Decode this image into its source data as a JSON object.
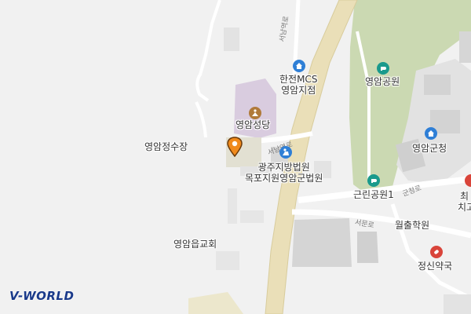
{
  "map": {
    "brand_logo": "V-WORLD",
    "places": [
      {
        "id": "hanjeon",
        "lines": [
          "한전MCS",
          "영암지점"
        ]
      },
      {
        "id": "yeongam-park",
        "lines": [
          "영암공원"
        ]
      },
      {
        "id": "yeongam-cathedral",
        "lines": [
          "영암성당"
        ]
      },
      {
        "id": "water-station",
        "lines": [
          "영암정수장"
        ]
      },
      {
        "id": "court",
        "lines": [
          "광주지방법원",
          "목포지원영암군법원"
        ]
      },
      {
        "id": "county-office",
        "lines": [
          "영암군청"
        ]
      },
      {
        "id": "neighborhood-park",
        "lines": [
          "근린공원1"
        ]
      },
      {
        "id": "academy",
        "lines": [
          "월출학원"
        ]
      },
      {
        "id": "church",
        "lines": [
          "영암읍교회"
        ]
      },
      {
        "id": "pharmacy",
        "lines": [
          "정신약국"
        ]
      },
      {
        "id": "dental-partial",
        "lines": [
          "최",
          "치고"
        ]
      }
    ],
    "roads": [
      {
        "id": "seonam-ro-upper",
        "name": "서남역로"
      },
      {
        "id": "seonam-ro-lower",
        "name": "서남역로"
      },
      {
        "id": "gunchung-ro",
        "name": "군청로"
      },
      {
        "id": "seomun-ro",
        "name": "서문로"
      }
    ],
    "colors": {
      "background": "#f1f1f1",
      "main_road": "#e9dfb8",
      "park_green": "#c9d9b0",
      "building": "#dcdcdc",
      "building_purple": "#d8cadd",
      "poi_blue": "#2f7fd6",
      "poi_teal": "#1a9a8c",
      "poi_brown": "#b07a3a",
      "poi_red": "#d9443a",
      "pin_orange": "#f08a1c"
    }
  }
}
